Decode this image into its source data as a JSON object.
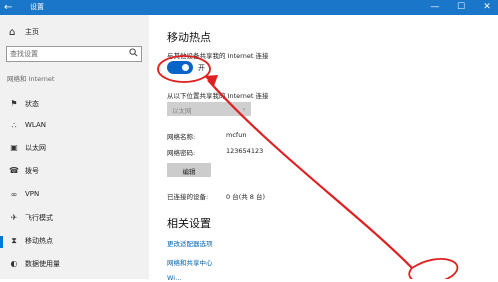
{
  "window": {
    "title": "设置",
    "back_icon": "back-arrow-icon",
    "minimize_glyph": "—",
    "maximize_glyph": "☐",
    "close_glyph": "✕"
  },
  "sidebar": {
    "home_label": "主页",
    "search_placeholder": "查找设置",
    "section_label": "网络和 Internet",
    "items": [
      {
        "label": "状态",
        "icon": "status-icon"
      },
      {
        "label": "WLAN",
        "icon": "wifi-icon"
      },
      {
        "label": "以太网",
        "icon": "ethernet-icon"
      },
      {
        "label": "拨号",
        "icon": "dialup-icon"
      },
      {
        "label": "VPN",
        "icon": "vpn-icon"
      },
      {
        "label": "飞行模式",
        "icon": "airplane-icon"
      },
      {
        "label": "移动热点",
        "icon": "hotspot-icon",
        "active": true
      },
      {
        "label": "数据使用量",
        "icon": "data-usage-icon"
      }
    ]
  },
  "main": {
    "title": "移动热点",
    "share_label": "与其他设备共享我的 Internet 连接",
    "toggle": {
      "state": true,
      "text": "开"
    },
    "share_from_label": "从以下位置共享我的 Internet 连接",
    "share_from_value": "以太网",
    "network_name_label": "网络名称:",
    "network_name_value": "mcfun",
    "network_password_label": "网络密码:",
    "network_password_value": "123654123",
    "edit_button": "编辑",
    "connected_devices_label": "已连接的设备:",
    "connected_devices_value": "0 台(共 8 台)",
    "related_title": "相关设置",
    "links": [
      "更改适配器选项",
      "网络和共享中心",
      "Wi…"
    ]
  },
  "colors": {
    "titlebar": "#1976c9",
    "accent": "#0078d7",
    "toggle_on": "#0a63c7",
    "link": "#0063b1",
    "annotation": "#e02020"
  }
}
